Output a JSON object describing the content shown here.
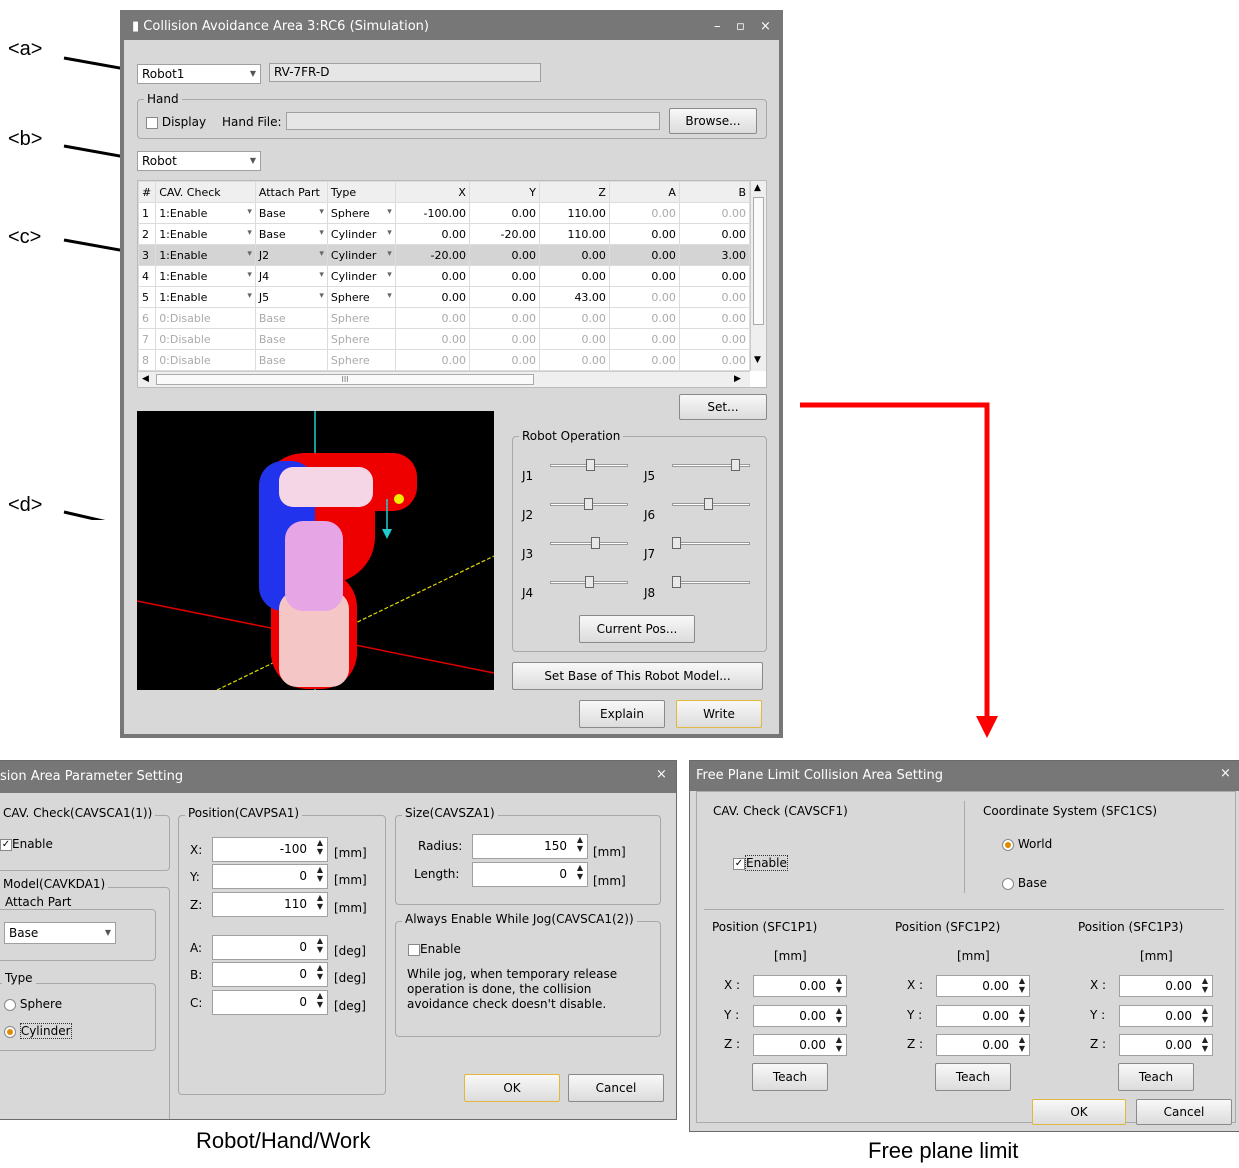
{
  "annotations": [
    "<a>",
    "<b>",
    "<c>",
    "<d>"
  ],
  "main": {
    "title": "Collision Avoidance Area 3:RC6  (Simulation)",
    "title_controls": [
      "–",
      "▫",
      "×"
    ],
    "robot_select": "Robot1",
    "robot_model": "RV-7FR-D",
    "hand_group": "Hand",
    "display_label": "Display",
    "hand_file_label": "Hand File:",
    "browse_label": "Browse...",
    "target_select": "Robot",
    "table": {
      "headers": [
        "#",
        "CAV. Check",
        "Attach Part",
        "Type",
        "X",
        "Y",
        "Z",
        "A",
        "B"
      ],
      "rows": [
        [
          "1",
          "1:Enable",
          "Base",
          "Sphere",
          "-100.00",
          "0.00",
          "110.00",
          "0.00",
          "0.00"
        ],
        [
          "2",
          "1:Enable",
          "Base",
          "Cylinder",
          "0.00",
          "-20.00",
          "110.00",
          "0.00",
          "0.00"
        ],
        [
          "3",
          "1:Enable",
          "J2",
          "Cylinder",
          "-20.00",
          "0.00",
          "0.00",
          "0.00",
          "3.00"
        ],
        [
          "4",
          "1:Enable",
          "J4",
          "Cylinder",
          "0.00",
          "0.00",
          "0.00",
          "0.00",
          "0.00"
        ],
        [
          "5",
          "1:Enable",
          "J5",
          "Sphere",
          "0.00",
          "0.00",
          "43.00",
          "0.00",
          "0.00"
        ],
        [
          "6",
          "0:Disable",
          "Base",
          "Sphere",
          "0.00",
          "0.00",
          "0.00",
          "0.00",
          "0.00"
        ],
        [
          "7",
          "0:Disable",
          "Base",
          "Sphere",
          "0.00",
          "0.00",
          "0.00",
          "0.00",
          "0.00"
        ],
        [
          "8",
          "0:Disable",
          "Base",
          "Sphere",
          "0.00",
          "0.00",
          "0.00",
          "0.00",
          "0.00"
        ]
      ],
      "scroll_mark": "III"
    },
    "set_label": "Set...",
    "robot_operation": "Robot Operation",
    "joints": [
      "J1",
      "J2",
      "J3",
      "J4",
      "J5",
      "J6",
      "J7",
      "J8"
    ],
    "current_pos_label": "Current Pos...",
    "set_base_label": "Set Base of This Robot Model...",
    "explain_label": "Explain",
    "write_label": "Write"
  },
  "left_dialog": {
    "title": "sion Area Parameter Setting",
    "close": "×",
    "cav_group": "CAV. Check(CAVSCA1(1))",
    "enable_label": "Enable",
    "model_group": "Model(CAVKDA1)",
    "attach_group": "Attach Part",
    "attach_value": "Base",
    "type_group": "Type",
    "sphere_label": "Sphere",
    "cylinder_label": "Cylinder",
    "position_group": "Position(CAVPSA1)",
    "pos_fields": [
      {
        "label": "X:",
        "value": "-100",
        "unit": "[mm]"
      },
      {
        "label": "Y:",
        "value": "0",
        "unit": "[mm]"
      },
      {
        "label": "Z:",
        "value": "110",
        "unit": "[mm]"
      },
      {
        "label": "A:",
        "value": "0",
        "unit": "[deg]"
      },
      {
        "label": "B:",
        "value": "0",
        "unit": "[deg]"
      },
      {
        "label": "C:",
        "value": "0",
        "unit": "[deg]"
      }
    ],
    "size_group": "Size(CAVSZA1)",
    "radius_label": "Radius:",
    "radius_value": "150",
    "length_label": "Length:",
    "length_value": "0",
    "size_unit": "[mm]",
    "jog_group": "Always Enable While Jog(CAVSCA1(2))",
    "jog_enable": "Enable",
    "jog_note": "While jog, when temporary release operation is done, the collision avoidance check doesn't disable.",
    "ok": "OK",
    "cancel": "Cancel"
  },
  "right_dialog": {
    "title": "Free Plane Limit Collision Area Setting",
    "close": "×",
    "cav_label": "CAV. Check (CAVSCF1)",
    "enable_label": "Enable",
    "coord_label": "Coordinate System (SFC1CS)",
    "world_label": "World",
    "base_label": "Base",
    "positions": [
      {
        "title": "Position (SFC1P1)",
        "unit": "[mm]",
        "x": "0.00",
        "y": "0.00",
        "z": "0.00",
        "teach": "Teach"
      },
      {
        "title": "Position (SFC1P2)",
        "unit": "[mm]",
        "x": "0.00",
        "y": "0.00",
        "z": "0.00",
        "teach": "Teach"
      },
      {
        "title": "Position (SFC1P3)",
        "unit": "[mm]",
        "x": "0.00",
        "y": "0.00",
        "z": "0.00",
        "teach": "Teach"
      }
    ],
    "axis_labels": [
      "X :",
      "Y :",
      "Z :"
    ],
    "ok": "OK",
    "cancel": "Cancel"
  },
  "captions": {
    "left": "Robot/Hand/Work",
    "right": "Free plane limit"
  },
  "colors": {
    "arrow_red": "#ff0000",
    "window_bg": "#d8d8d8",
    "title_bar": "#777777",
    "radio_on": "#e08a00"
  }
}
